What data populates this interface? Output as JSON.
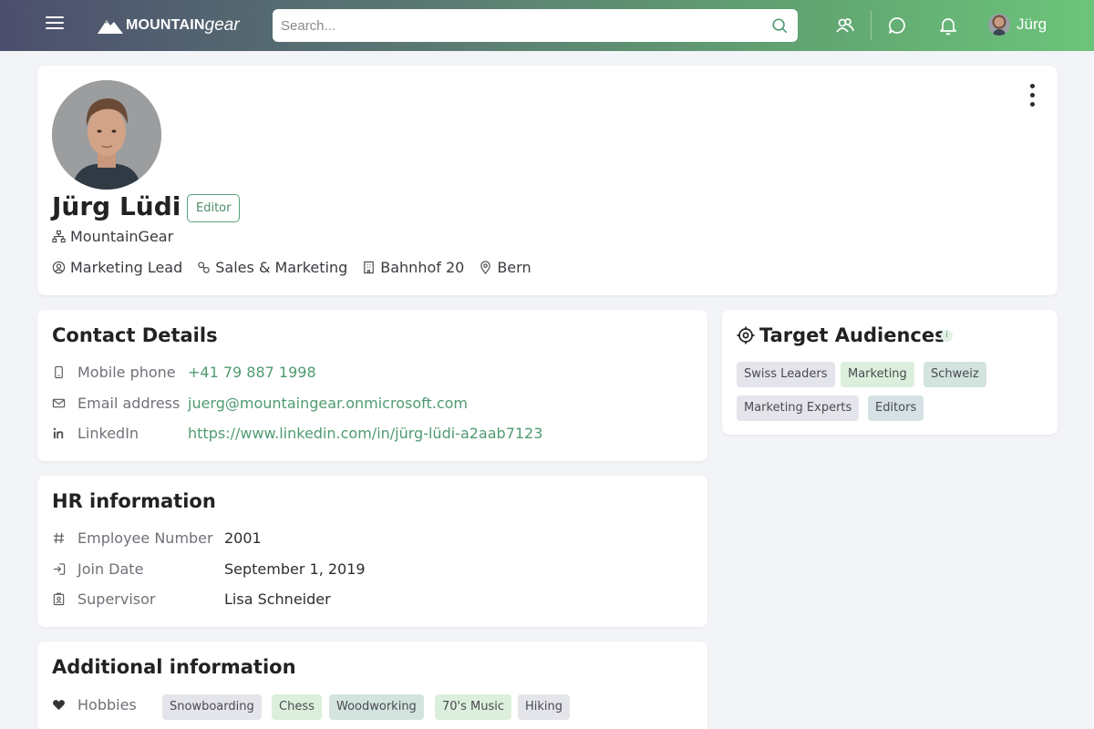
{
  "header": {
    "logo_bold": "MOUNTAIN",
    "logo_italic": "gear",
    "search_placeholder": "Search...",
    "user_name": "Jürg",
    "icons": [
      "menu-icon",
      "search-icon",
      "people-icon",
      "chat-icon",
      "bell-icon"
    ]
  },
  "profile": {
    "name": "Jürg Lüdi",
    "badge": "Editor",
    "company": "MountainGear",
    "position": "Marketing Lead",
    "department": "Sales & Marketing",
    "office": "Bahnhof 20",
    "city": "Bern"
  },
  "contact": {
    "title": "Contact Details",
    "rows": [
      {
        "label": "Mobile phone",
        "value": "+41 79 887 1998",
        "icon": "mobile-icon"
      },
      {
        "label": "Email address",
        "value": "juerg@mountaingear.onmicrosoft.com",
        "icon": "mail-icon"
      },
      {
        "label": "LinkedIn",
        "value": "https://www.linkedin.com/in/jürg-lüdi-a2aab7123",
        "icon": "linkedin-icon"
      }
    ]
  },
  "hr": {
    "title": "HR information",
    "rows": [
      {
        "label": "Employee Number",
        "value": "2001",
        "icon": "hash-icon"
      },
      {
        "label": "Join Date",
        "value": "September 1, 2019",
        "icon": "join-icon"
      },
      {
        "label": "Supervisor",
        "value": "Lisa Schneider",
        "icon": "badge-icon"
      }
    ]
  },
  "additional": {
    "title": "Additional information",
    "hobbies_label": "Hobbies",
    "hobbies": [
      "Snowboarding",
      "Chess",
      "Woodworking",
      "70's Music",
      "Hiking"
    ]
  },
  "audiences": {
    "title": "Target Audiences",
    "info": "i",
    "tags": [
      "Swiss Leaders",
      "Marketing",
      "Schweiz",
      "Marketing Experts",
      "Editors"
    ]
  },
  "colors": {
    "accent": "#4f9b70",
    "header_start": "#4c4f6d",
    "header_end": "#6cc47a",
    "background": "#f3f4f7"
  }
}
